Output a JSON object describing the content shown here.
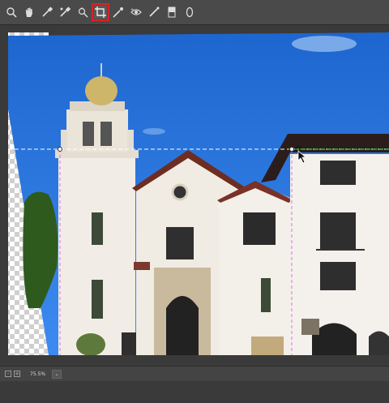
{
  "toolbar": {
    "tools": [
      {
        "name": "zoom-tool-icon"
      },
      {
        "name": "hand-tool-icon"
      },
      {
        "name": "eyedropper-tool-icon"
      },
      {
        "name": "color-sampler-icon"
      },
      {
        "name": "targeted-adjustment-icon"
      },
      {
        "name": "crop-tool-icon",
        "active": true
      },
      {
        "name": "spot-removal-icon"
      },
      {
        "name": "red-eye-icon"
      },
      {
        "name": "adjustment-brush-icon"
      },
      {
        "name": "graduated-filter-icon"
      },
      {
        "name": "radial-filter-icon"
      }
    ],
    "active_outline_color": "#d22222"
  },
  "status": {
    "zoom": "75.5%"
  },
  "colors": {
    "sky": "#1f6fd6",
    "building": "#f2eee8",
    "roof": "#3a1f1a",
    "guide_white": "#ffffff",
    "guide_magenta": "#e070e0",
    "guide_green": "#22cc22"
  }
}
